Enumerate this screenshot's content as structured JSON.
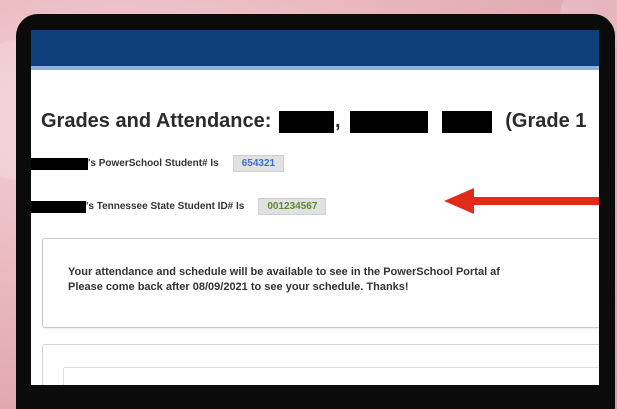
{
  "page": {
    "title_label": "Grades and Attendance:",
    "title_separator": ",",
    "grade_text": "(Grade 1"
  },
  "ids": {
    "powerschool_label": "'s PowerSchool Student# Is",
    "powerschool_id": "654321",
    "tn_label": "'s Tennessee State Student ID# Is",
    "tn_id": "001234567"
  },
  "notice": {
    "line1": "Your attendance and schedule will be available to see in the PowerSchool Portal af",
    "line2": "Please come back after 08/09/2021 to see your schedule. Thanks!"
  },
  "colors": {
    "header_blue": "#0f3f7a",
    "arrow_red": "#e02a1c",
    "powerschool_id_text": "#3c6ed6",
    "tn_id_text": "#5b8a2a"
  }
}
